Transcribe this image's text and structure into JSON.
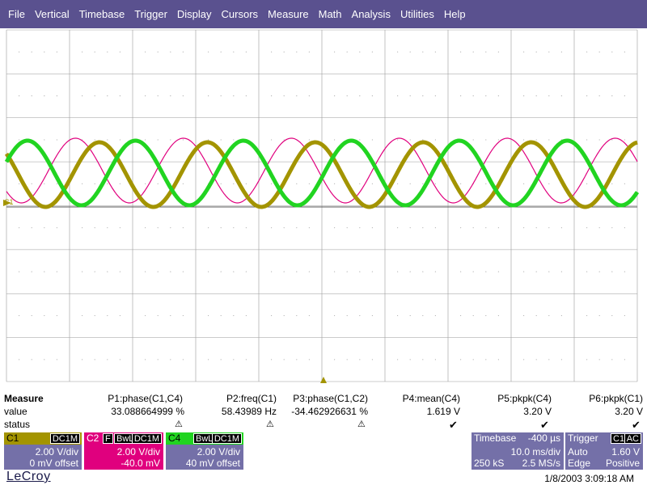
{
  "menu": [
    "File",
    "Vertical",
    "Timebase",
    "Trigger",
    "Display",
    "Cursors",
    "Measure",
    "Math",
    "Analysis",
    "Utilities",
    "Help"
  ],
  "colors": {
    "menubar": "#5a518f",
    "c1": "#a39400",
    "c2": "#e0007e",
    "c4": "#21d421",
    "panel": "#7470a8",
    "grid": "#9a9a9a"
  },
  "trace": {
    "freq_hz": 58.43989,
    "ms_per_div": 10,
    "c1_offset_div": -0.05,
    "c4_offset_div": 0.1
  },
  "channel_marker": "C1",
  "measure": {
    "title": "Measure",
    "row_value": "value",
    "row_status": "status",
    "params": [
      {
        "label": "P1:phase(C1,C4)",
        "value": "33.088664999",
        "unit": "%",
        "status": "warning"
      },
      {
        "label": "P2:freq(C1)",
        "value": "58.43989",
        "unit": "Hz",
        "status": "warning"
      },
      {
        "label": "P3:phase(C1,C2)",
        "value": "-34.462926631",
        "unit": "%",
        "status": "warning"
      },
      {
        "label": "P4:mean(C4)",
        "value": "1.619",
        "unit": "V",
        "status": "ok"
      },
      {
        "label": "P5:pkpk(C4)",
        "value": "3.20",
        "unit": "V",
        "status": "ok"
      },
      {
        "label": "P6:pkpk(C1)",
        "value": "3.20",
        "unit": "V",
        "status": "ok"
      }
    ]
  },
  "channels": {
    "c1": {
      "name": "C1",
      "coupling": "DC1M",
      "vdiv": "2.00 V/div",
      "offset": "0 mV offset"
    },
    "c2": {
      "name": "C2",
      "filter": "F",
      "bw": "BwL",
      "coupling": "DC1M",
      "vdiv": "2.00 V/div",
      "offset": "-40.0 mV"
    },
    "c4": {
      "name": "C4",
      "bw": "BwL",
      "coupling": "DC1M",
      "vdiv": "2.00 V/div",
      "offset": "40 mV offset"
    }
  },
  "timebase": {
    "title": "Timebase",
    "delay": "-400 µs",
    "tdiv": "10.0 ms/div",
    "samples": "250 kS",
    "rate": "2.5 MS/s"
  },
  "trigger": {
    "title": "Trigger",
    "source": "C1",
    "coupling": "AC",
    "mode": "Auto",
    "level": "1.60 V",
    "type": "Edge",
    "slope": "Positive"
  },
  "footer": {
    "brand": "LeCroy",
    "datetime": "1/8/2003 3:09:18 AM"
  }
}
